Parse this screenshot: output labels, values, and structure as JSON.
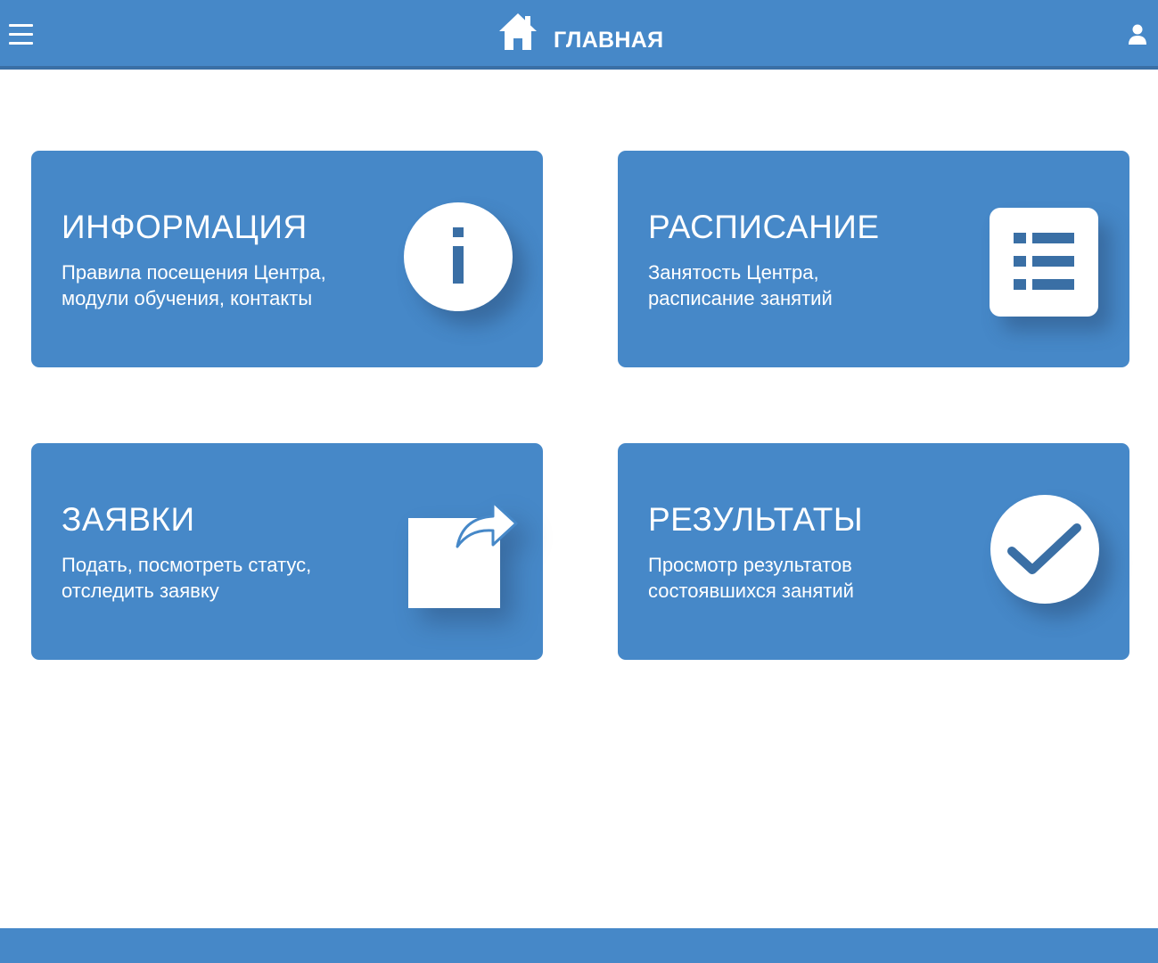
{
  "header": {
    "title": "ГЛАВНАЯ",
    "menu_icon": "hamburger-menu-icon",
    "home_icon": "home-icon",
    "user_icon": "user-icon"
  },
  "cards": [
    {
      "title": "ИНФОРМАЦИЯ",
      "desc_line1": "Правила посещения Центра,",
      "desc_line2": "модули обучения, контакты",
      "icon": "info-icon"
    },
    {
      "title": "РАСПИСАНИЕ",
      "desc_line1": "Занятость Центра,",
      "desc_line2": "расписание занятий",
      "icon": "list-icon"
    },
    {
      "title": "ЗАЯВКИ",
      "desc_line1": "Подать, посмотреть статус,",
      "desc_line2": "отследить заявку",
      "icon": "share-icon"
    },
    {
      "title": "РЕЗУЛЬТАТЫ",
      "desc_line1": "Просмотр результатов",
      "desc_line2": "состоявшихся занятий",
      "icon": "checkmark-icon"
    }
  ],
  "colors": {
    "primary": "#4688c8",
    "header_border": "#3a6fa5",
    "icon_dark": "#3a6fa5",
    "text": "#ffffff"
  }
}
